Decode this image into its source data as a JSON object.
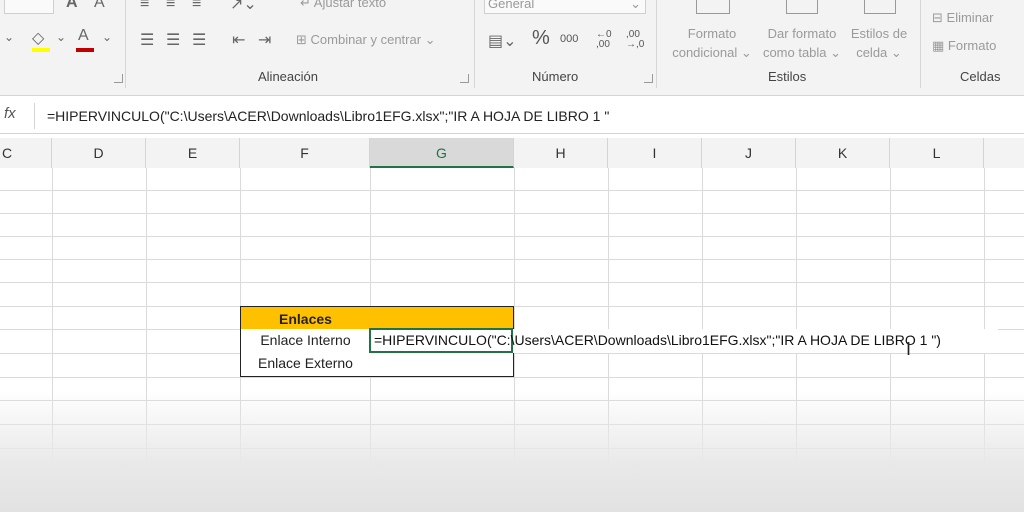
{
  "ribbon": {
    "wrap_text": "Ajustar texto",
    "merge_center": "Combinar y centrar",
    "number_format": "General",
    "percent_symbol": "%",
    "thousands_symbol": "000",
    "conditional_format": [
      "Formato",
      "condicional"
    ],
    "format_table": [
      "Dar formato",
      "como tabla"
    ],
    "cell_styles": [
      "Estilos de",
      "celda"
    ],
    "delete": "Eliminar",
    "format": "Formato",
    "groups": {
      "alignment": "Alineación",
      "number": "Número",
      "styles": "Estilos",
      "cells": "Celdas"
    }
  },
  "formula_bar": {
    "fx": "fx",
    "text": "=HIPERVINCULO(\"C:\\Users\\ACER\\Downloads\\Libro1EFG.xlsx\";\"IR A HOJA DE LIBRO 1 \""
  },
  "columns": [
    "C",
    "D",
    "E",
    "F",
    "G",
    "H",
    "I",
    "J",
    "K",
    "L"
  ],
  "selected_column": "G",
  "table": {
    "header": "Enlaces",
    "row1_label": "Enlace Interno",
    "row2_label": "Enlace Externo",
    "editing_text": "=HIPERVINCULO(\"C:\\Users\\ACER\\Downloads\\Libro1EFG.xlsx\";\"IR A HOJA DE LIBRO 1 \")"
  },
  "colors": {
    "header_fill": "#ffc000",
    "accent": "#217346"
  }
}
